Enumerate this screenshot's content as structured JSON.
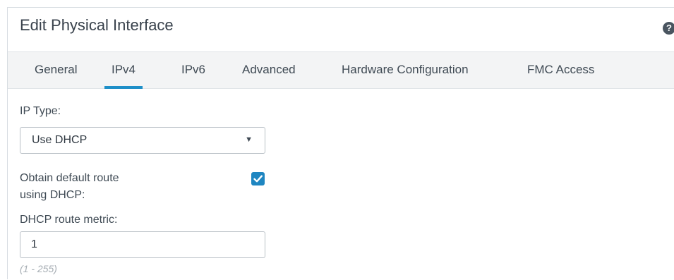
{
  "dialog": {
    "title": "Edit Physical Interface",
    "help_icon": "?"
  },
  "tabs": [
    {
      "label": "General",
      "active": false
    },
    {
      "label": "IPv4",
      "active": true
    },
    {
      "label": "IPv6",
      "active": false
    },
    {
      "label": "Advanced",
      "active": false
    },
    {
      "label": "Hardware Configuration",
      "active": false
    },
    {
      "label": "FMC Access",
      "active": false
    }
  ],
  "form": {
    "ip_type_label": "IP Type:",
    "ip_type_value": "Use DHCP",
    "ip_type_caret": "▼",
    "default_route_label_line1": "Obtain default route",
    "default_route_label_line2": "using DHCP:",
    "default_route_checked": true,
    "route_metric_label": "DHCP route metric:",
    "route_metric_value": "1",
    "route_metric_hint": "(1 - 255)"
  },
  "colors": {
    "accent": "#1e8fc8",
    "checkbox": "#1f86c1",
    "tabbar_bg": "#f3f4f5",
    "text": "#3f4a54"
  }
}
